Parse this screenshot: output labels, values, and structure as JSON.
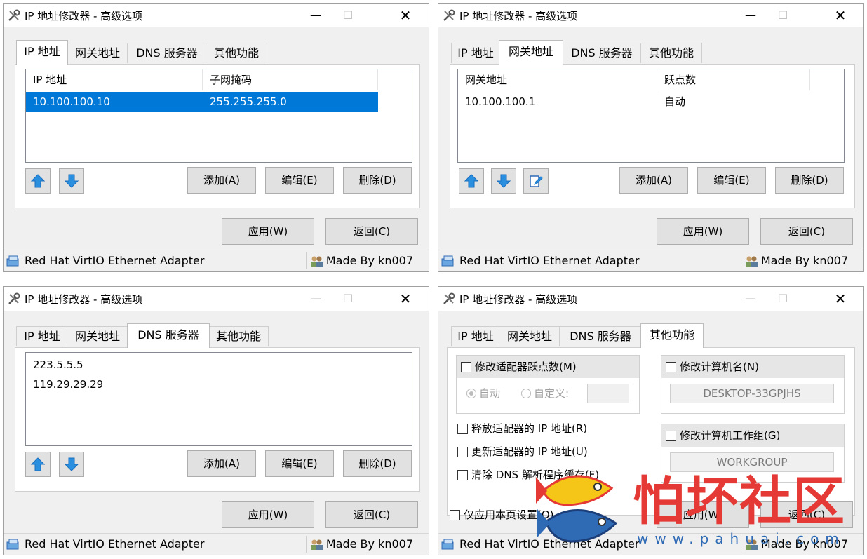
{
  "app": {
    "title": "IP 地址修改器 - 高级选项",
    "minimize": "—",
    "maximize": "☐",
    "close": "✕"
  },
  "tabs": [
    "IP 地址",
    "网关地址",
    "DNS 服务器",
    "其他功能"
  ],
  "buttons": {
    "add": "添加(A)",
    "edit": "编辑(E)",
    "delete": "删除(D)",
    "apply": "应用(W)",
    "back": "返回(C)"
  },
  "status": {
    "adapter": "Red Hat VirtIO Ethernet Adapter",
    "author": "Made By kn007"
  },
  "ip_tab": {
    "columns": [
      "IP 地址",
      "子网掩码"
    ],
    "rows": [
      {
        "ip": "10.100.100.10",
        "mask": "255.255.255.0"
      }
    ]
  },
  "gateway_tab": {
    "columns": [
      "网关地址",
      "跃点数"
    ],
    "rows": [
      {
        "gateway": "10.100.100.1",
        "metric": "自动"
      }
    ]
  },
  "dns_tab": {
    "servers": [
      "223.5.5.5",
      "119.29.29.29"
    ]
  },
  "other_tab": {
    "metric_group": "修改适配器跃点数(M)",
    "auto_label": "自动",
    "custom_label": "自定义:",
    "hostname_group": "修改计算机名(N)",
    "hostname_value": "DESKTOP-33GPJHS",
    "workgroup_group": "修改计算机工作组(G)",
    "workgroup_value": "WORKGROUP",
    "release": "释放适配器的 IP 地址(R)",
    "renew": "更新适配器的 IP 地址(U)",
    "flush_dns": "清除 DNS 解析程序缓存(F)",
    "apply_page_only": "仅应用本页设置(O)"
  },
  "watermark": {
    "text": "怕坏社区",
    "url": "www.pahuai.com"
  },
  "colors": {
    "selection": "#0078d7",
    "arrow": "#2b8fe0",
    "watermark_red": "#e53935",
    "watermark_blue": "#2f6ab5"
  },
  "icons": [
    "tools-icon",
    "arrow-up-icon",
    "arrow-down-icon",
    "edit-metric-icon",
    "network-adapter-icon",
    "users-icon"
  ]
}
